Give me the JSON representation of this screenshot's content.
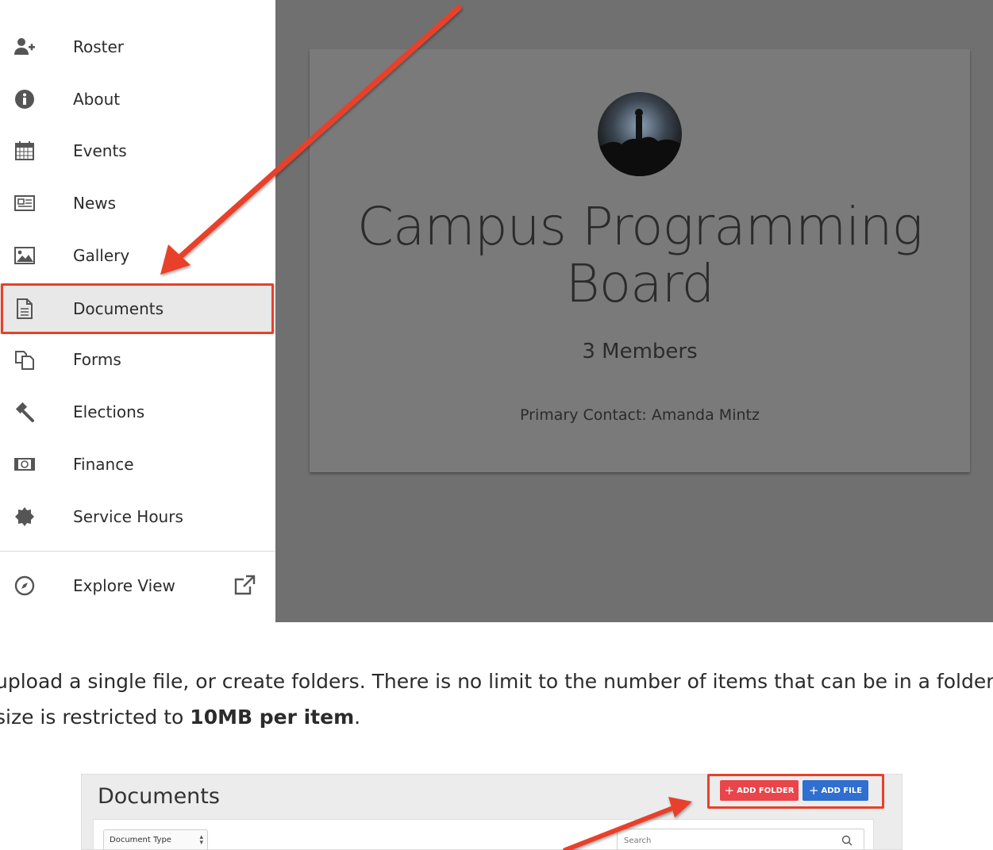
{
  "sidebar": {
    "items": [
      {
        "label": "Roster",
        "icon": "add-user-icon"
      },
      {
        "label": "About",
        "icon": "info-icon"
      },
      {
        "label": "Events",
        "icon": "calendar-icon"
      },
      {
        "label": "News",
        "icon": "newspaper-icon"
      },
      {
        "label": "Gallery",
        "icon": "image-icon"
      },
      {
        "label": "Documents",
        "icon": "document-icon"
      },
      {
        "label": "Forms",
        "icon": "forms-icon"
      },
      {
        "label": "Elections",
        "icon": "gavel-icon"
      },
      {
        "label": "Finance",
        "icon": "money-icon"
      },
      {
        "label": "Service Hours",
        "icon": "badge-icon"
      }
    ],
    "explore": {
      "label": "Explore View",
      "icon": "compass-icon",
      "external_icon": "external-link-icon"
    },
    "active_item": "Documents"
  },
  "profile": {
    "org_name": "Campus Programming Board",
    "member_count": "3 Members",
    "primary_contact": "Primary Contact: Amanda Mintz"
  },
  "prose": {
    "line1": "upload a single file, or create folders.  There is no limit to the number of items that can be in a folder",
    "line2_prefix": "size is restricted to",
    "line2_bold": "10MB per item",
    "line2_suffix": "."
  },
  "documents_panel": {
    "title": "Documents",
    "add_folder_label": "ADD FOLDER",
    "add_file_label": "ADD FILE",
    "document_type_select": "Document Type",
    "search_placeholder": "Search"
  },
  "colors": {
    "annotation_red": "#e8402a",
    "add_folder": "#e9454a",
    "add_file": "#2f6fcf",
    "overlay_gray": "#707070"
  }
}
